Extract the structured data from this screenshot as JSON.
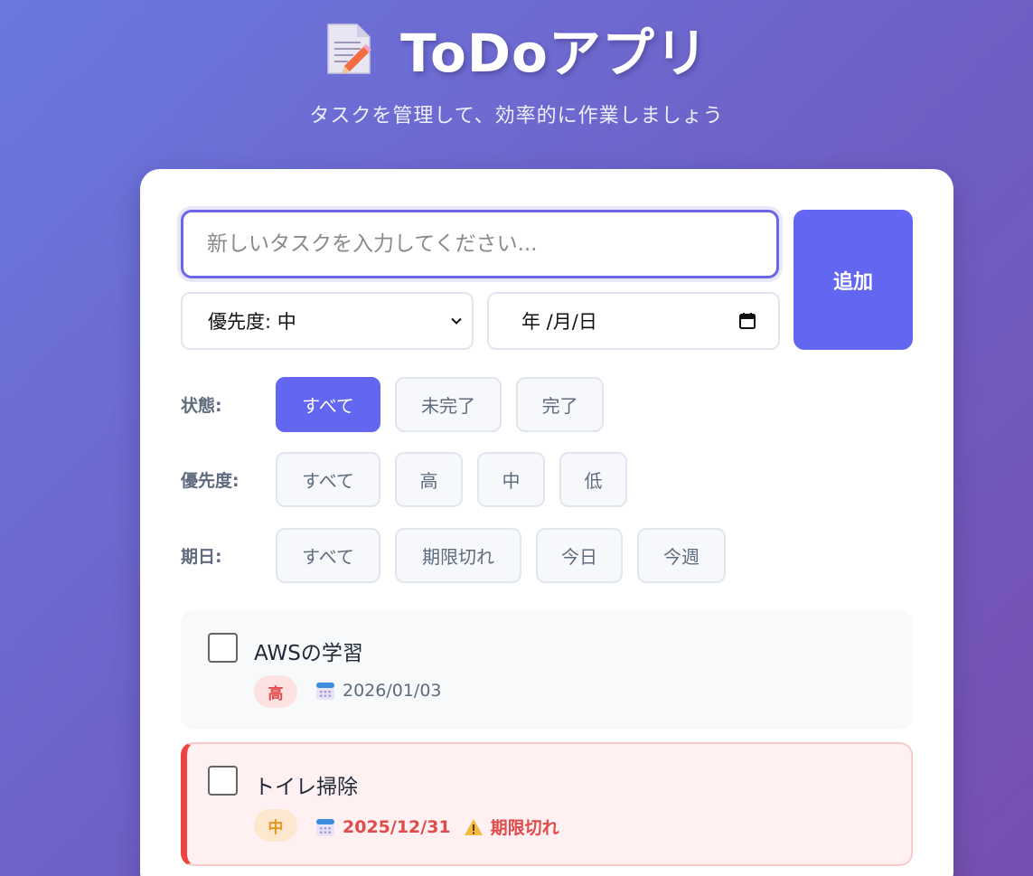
{
  "header": {
    "title": "ToDoアプリ",
    "subtitle": "タスクを管理して、効率的に作業しましょう",
    "icon": "memo-icon"
  },
  "form": {
    "task_placeholder": "新しいタスクを入力してください...",
    "task_value": "",
    "priority_selected": "優先度: 中",
    "date_placeholder": "年 /月/日",
    "add_label": "追加"
  },
  "filters": {
    "status": {
      "label": "状態:",
      "options": [
        "すべて",
        "未完了",
        "完了"
      ],
      "active": "すべて"
    },
    "priority": {
      "label": "優先度:",
      "options": [
        "すべて",
        "高",
        "中",
        "低"
      ],
      "active": ""
    },
    "due": {
      "label": "期日:",
      "options": [
        "すべて",
        "期限切れ",
        "今日",
        "今週"
      ],
      "active": ""
    }
  },
  "todos": [
    {
      "title": "AWSの学習",
      "priority": "高",
      "due": "2026/01/03",
      "overdue_label": "",
      "completed": false
    },
    {
      "title": "トイレ掃除",
      "priority": "中",
      "due": "2025/12/31",
      "overdue_label": "期限切れ",
      "completed": false
    }
  ],
  "colors": {
    "accent": "#6366f1",
    "overdue": "#ef4444",
    "priority_high": "#e24b4b",
    "priority_mid": "#e8961c"
  }
}
